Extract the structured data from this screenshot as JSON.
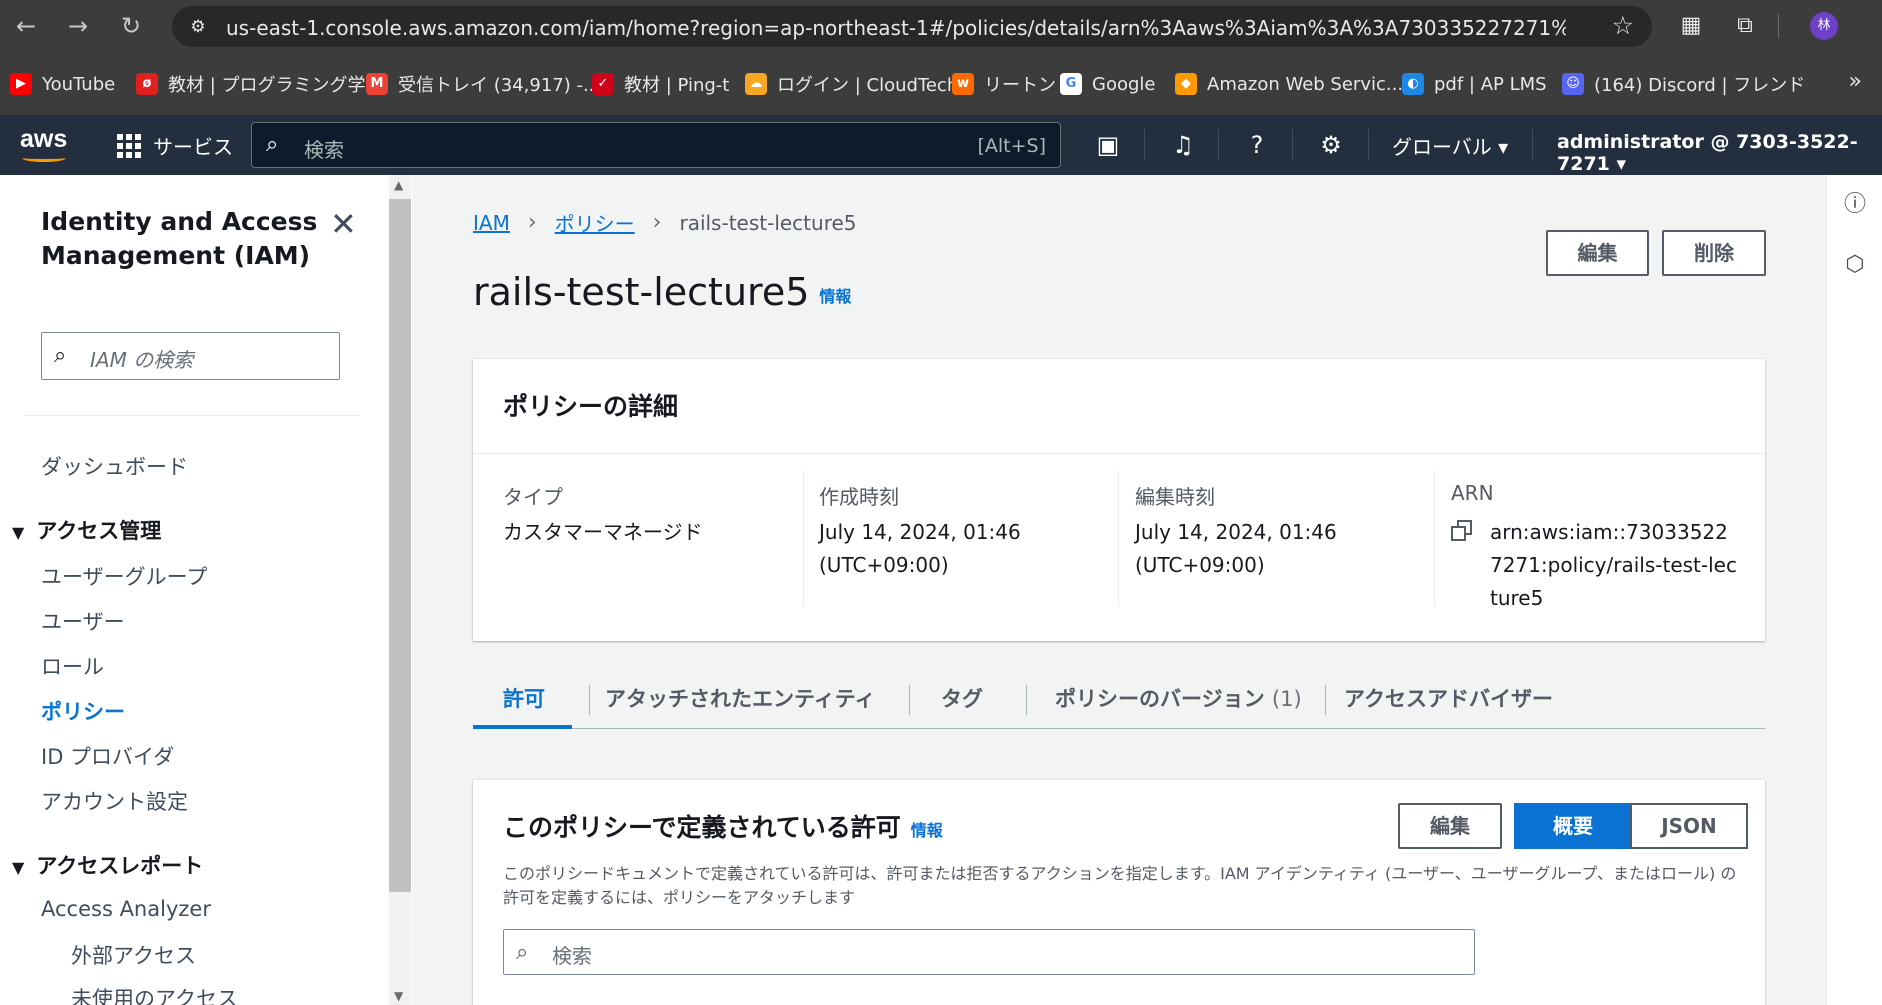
{
  "browser": {
    "url": "us-east-1.console.aws.amazon.com/iam/home?region=ap-northeast-1#/policies/details/arn%3Aaws%3Aiam%3A%3A730335227271%3Apolicy%2...",
    "profile_initial": "林",
    "bookmarks": [
      {
        "label": "YouTube",
        "icon": "youtube-icon",
        "color": "#ff0000"
      },
      {
        "label": "教材 | プログラミング学...",
        "icon": "progate-icon",
        "color": "#e0201f"
      },
      {
        "label": "受信トレイ (34,917) -...",
        "icon": "gmail-icon",
        "color": "#ea4335"
      },
      {
        "label": "教材 | Ping-t",
        "icon": "pingt-icon",
        "color": "#d0021b"
      },
      {
        "label": "ログイン | CloudTech",
        "icon": "cloudtech-icon",
        "color": "#f5a623"
      },
      {
        "label": "リートン",
        "icon": "wrtn-icon",
        "color": "#ff6a00"
      },
      {
        "label": "Google",
        "icon": "google-icon",
        "color": "#4285f4"
      },
      {
        "label": "Amazon Web Servic...",
        "icon": "aws-bookmark-icon",
        "color": "#ff9900"
      },
      {
        "label": "pdf | AP LMS",
        "icon": "aplms-icon",
        "color": "#1e88e5"
      },
      {
        "label": "(164) Discord | フレンド",
        "icon": "discord-icon",
        "color": "#5865f2"
      }
    ]
  },
  "aws_nav": {
    "logo_text": "aws",
    "services_label": "サービス",
    "search_placeholder": "検索",
    "search_shortcut": "[Alt+S]",
    "region_label": "グローバル ▾",
    "account_label": "administrator @ 7303-3522-7271 ▾"
  },
  "sidebar": {
    "title": "Identity and Access Management (IAM)",
    "search_placeholder": "IAM の検索",
    "dashboard": "ダッシュボード",
    "access_mgmt": {
      "label": "アクセス管理",
      "items": [
        "ユーザーグループ",
        "ユーザー",
        "ロール",
        "ポリシー",
        "ID プロバイダ",
        "アカウント設定"
      ]
    },
    "access_reports": {
      "label": "アクセスレポート",
      "items": [
        "Access Analyzer"
      ],
      "sub_items": [
        "外部アクセス",
        "未使用のアクセス"
      ]
    }
  },
  "breadcrumb": {
    "iam": "IAM",
    "policies": "ポリシー",
    "current": "rails-test-lecture5"
  },
  "page": {
    "title": "rails-test-lecture5",
    "info": "情報",
    "edit_button": "編集",
    "delete_button": "削除"
  },
  "details": {
    "title": "ポリシーの詳細",
    "type_label": "タイプ",
    "type_value": "カスタマーマネージド",
    "created_label": "作成時刻",
    "created_value": "July 14, 2024, 01:46 (UTC+09:00)",
    "edited_label": "編集時刻",
    "edited_value": "July 14, 2024, 01:46 (UTC+09:00)",
    "arn_label": "ARN",
    "arn_value": "arn:aws:iam::730335227271:policy/rails-test-lecture5"
  },
  "tabs": [
    {
      "label": "許可",
      "count": ""
    },
    {
      "label": "アタッチされたエンティティ",
      "count": ""
    },
    {
      "label": "タグ",
      "count": ""
    },
    {
      "label": "ポリシーのバージョン",
      "count": "(1)"
    },
    {
      "label": "アクセスアドバイザー",
      "count": ""
    }
  ],
  "permissions": {
    "title": "このポリシーで定義されている許可",
    "info": "情報",
    "description": "このポリシードキュメントで定義されている許可は、許可または拒否するアクションを指定します。IAM アイデンティティ (ユーザー、ユーザーグループ、またはロール) の許可を定義するには、ポリシーをアタッチします",
    "edit_button": "編集",
    "summary_button": "概要",
    "json_button": "JSON",
    "search_placeholder": "検索"
  }
}
